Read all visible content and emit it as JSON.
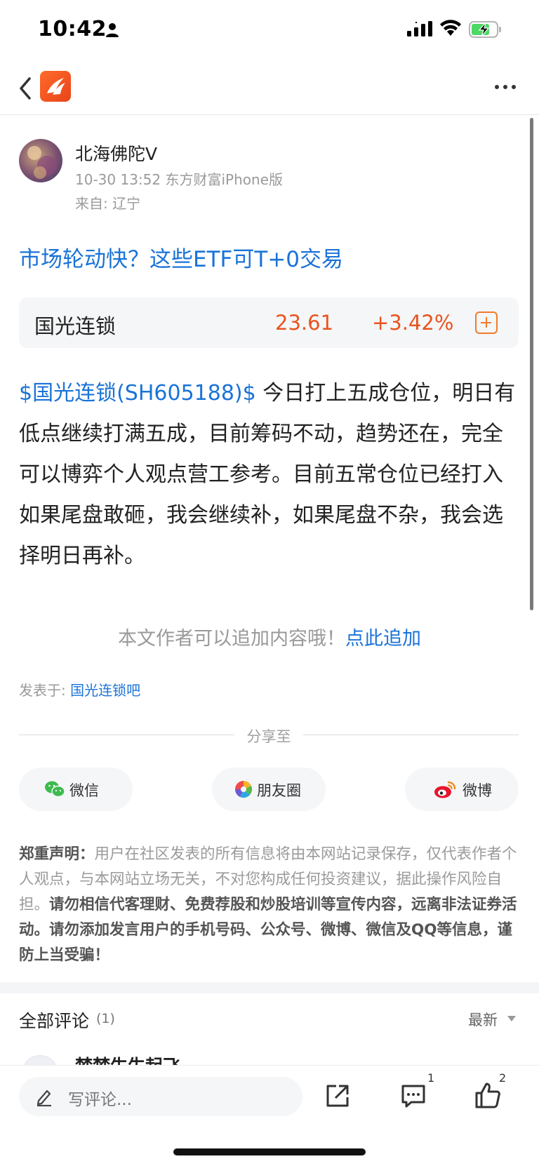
{
  "status_bar": {
    "time": "10:42"
  },
  "post": {
    "author": "北海佛陀V",
    "meta": "10-30 13:52 东方财富iPhone版",
    "location": "来自: 辽宁",
    "title": "市场轮动快？这些ETF可T+0交易",
    "stock": {
      "name": "国光连锁",
      "price": "23.61",
      "change": "+3.42%"
    },
    "body_tag": "$国光连锁(SH605188)$",
    "body_text": " 今日打上五成仓位，明日有低点继续打满五成，目前筹码不动，趋势还在，完全可以博弈个人观点营工参考。目前五常仓位已经打入如果尾盘敢砸，我会继续补，如果尾盘不杂，我会选择明日再补。",
    "append_hint": "本文作者可以追加内容哦！",
    "append_link": "点此追加",
    "posted_in_label": "发表于: ",
    "posted_in_bar": "国光连锁吧"
  },
  "share": {
    "label": "分享至",
    "wechat": "微信",
    "moments": "朋友圈",
    "weibo": "微博"
  },
  "disclaimer": {
    "label": "郑重声明：",
    "text1": "用户在社区发表的所有信息将由本网站记录保存，仅代表作者个人观点，与本网站立场无关，不对您构成任何投资建议，据此操作风险自担。",
    "text2": "请勿相信代客理财、免费荐股和炒股培训等宣传内容，远离非法证券活动。请勿添加发言用户的手机号码、公众号、微博、微信及QQ等信息，谨防上当受骗！"
  },
  "comments": {
    "title": "全部评论",
    "count": "(1)",
    "sort": "最新",
    "first_author": "梦梦生生起飞"
  },
  "bottom_bar": {
    "placeholder": "写评论...",
    "comment_badge": "1",
    "like_badge": "2"
  },
  "colors": {
    "link_blue": "#1a73d8",
    "stock_up": "#e8541e",
    "brand_orange": "#f07b2e"
  }
}
